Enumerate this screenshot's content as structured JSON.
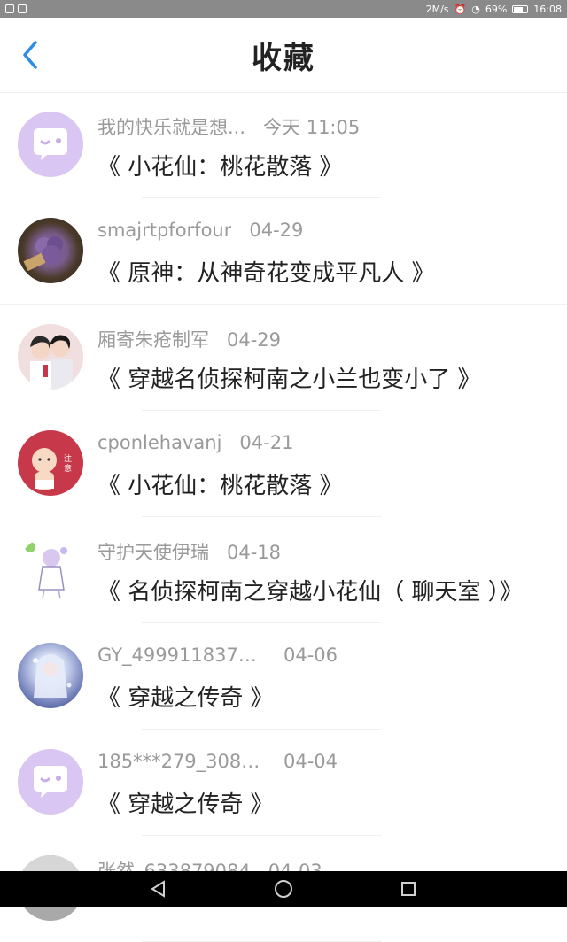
{
  "status": {
    "speed": "2M/s",
    "battery": "69%",
    "time": "16:08"
  },
  "header": {
    "title": "收藏"
  },
  "items": [
    {
      "user": "我的快乐就是想...",
      "time": "今天 11:05",
      "title": "《 小花仙：桃花散落 》"
    },
    {
      "user": "smajrtpforfour",
      "time": "04-29",
      "title": "《 原神：从神奇花变成平凡人 》"
    },
    {
      "user": "厢寄朱疮制军",
      "time": "04-29",
      "title": "《 穿越名侦探柯南之小兰也变小了 》"
    },
    {
      "user": "cponlehavanj",
      "time": "04-21",
      "title": "《 小花仙：桃花散落 》"
    },
    {
      "user": "守护天使伊瑞",
      "time": "04-18",
      "title": "《 名侦探柯南之穿越小花仙（ 聊天室 ）》"
    },
    {
      "user": "GY_4999118372...",
      "time": "04-06",
      "title": "《 穿越之传奇 》"
    },
    {
      "user": "185***279_3081...",
      "time": "04-04",
      "title": "《 穿越之传奇 》"
    },
    {
      "user": "张然_633879084",
      "time": "04-03",
      "title": ""
    }
  ],
  "colors": {
    "accent": "#2d8de6",
    "default_avatar": "#d9c6f2",
    "default_avatar_bubble": "#ffffff",
    "name_text": "#9a9a9a"
  }
}
